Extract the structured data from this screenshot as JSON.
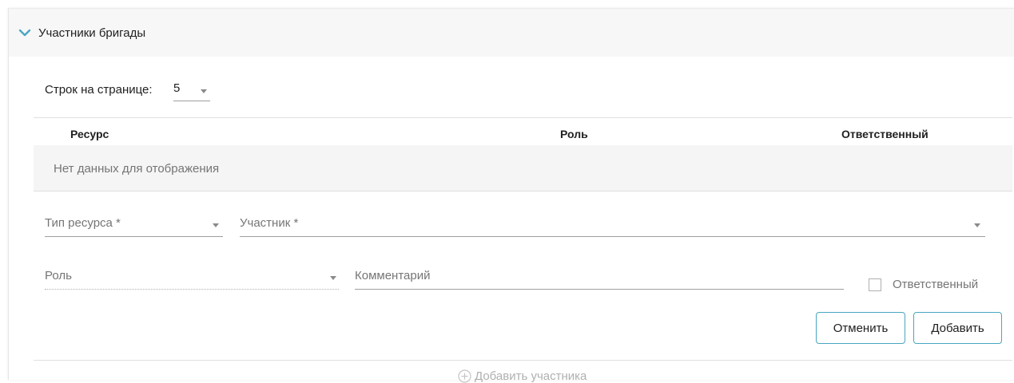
{
  "panel": {
    "title": "Участники бригады"
  },
  "pagination": {
    "rows_label": "Строк на странице:",
    "rows_value": "5"
  },
  "table": {
    "columns": [
      "Ресурс",
      "Роль",
      "Ответственный"
    ],
    "empty_message": "Нет данных для отображения"
  },
  "form": {
    "resource_type_label": "Тип ресурса *",
    "participant_label": "Участник *",
    "role_label": "Роль",
    "comment_label": "Комментарий",
    "responsible_label": "Ответственный",
    "responsible_checked": false,
    "cancel_label": "Отменить",
    "add_label": "Добавить"
  },
  "footer": {
    "add_member_label": "Добавить участника"
  },
  "colors": {
    "accent": "#4aa6c2",
    "header_bg": "#f7f7f7",
    "empty_row_bg": "#f5f5f5",
    "muted_text": "#757575",
    "disabled_text": "#b0b0b0"
  },
  "icons": {
    "panel_toggle": "chevron-down-icon",
    "add_member": "plus-circle-icon",
    "select_arrow": "caret-down-icon"
  }
}
